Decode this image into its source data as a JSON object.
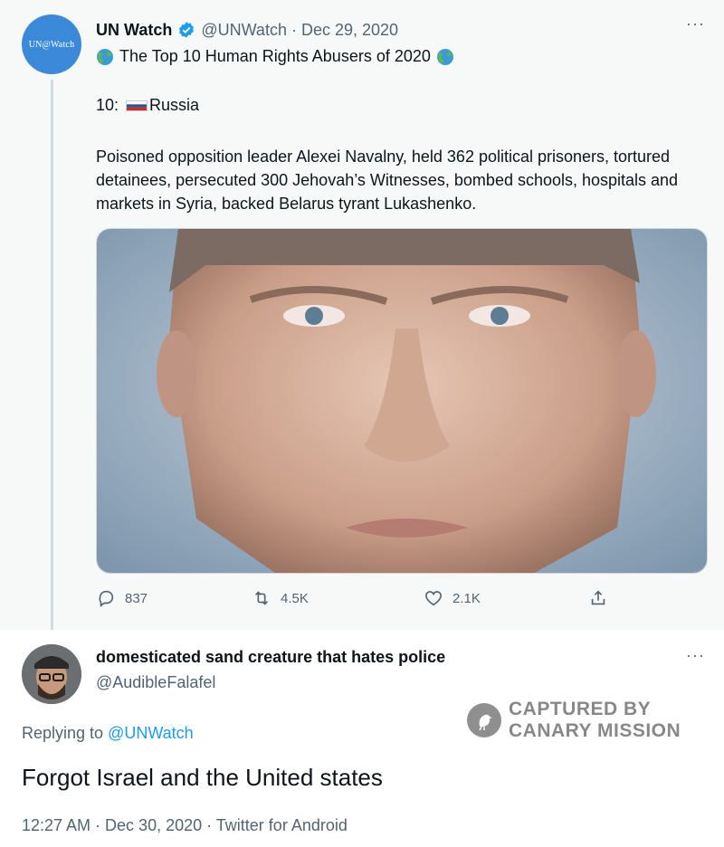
{
  "tweet": {
    "avatar_text": "UN@Watch",
    "name": "UN Watch",
    "handle": "@UNWatch",
    "separator": "·",
    "date": "Dec 29, 2020",
    "more": "···",
    "title_text": "The Top 10 Human Rights Abusers of 2020",
    "rank_prefix": "10:",
    "rank_country": "Russia",
    "body": "Poisoned opposition leader Alexei Navalny, held 362 political prisoners, tortured detainees, persecuted 300 Jehovah’s Witnesses, bombed schools, hospitals and markets in Syria, backed Belarus tyrant Lukashenko.",
    "actions": {
      "replies": "837",
      "retweets": "4.5K",
      "likes": "2.1K"
    }
  },
  "reply": {
    "name": "domesticated sand creature that hates police",
    "handle": "@AudibleFalafel",
    "more": "···",
    "replying_prefix": "Replying to",
    "replying_to": "@UNWatch",
    "text": "Forgot Israel and the United states",
    "meta": "12:27 AM · Dec 30, 2020 · Twitter for Android"
  },
  "watermark": {
    "line1": "CAPTURED BY",
    "line2": "CANARY MISSION"
  },
  "colors": {
    "accent": "#1d9bf0",
    "muted": "#536471",
    "verified": "#1d9bf0",
    "avatar_bg": "#3b8ad9"
  }
}
